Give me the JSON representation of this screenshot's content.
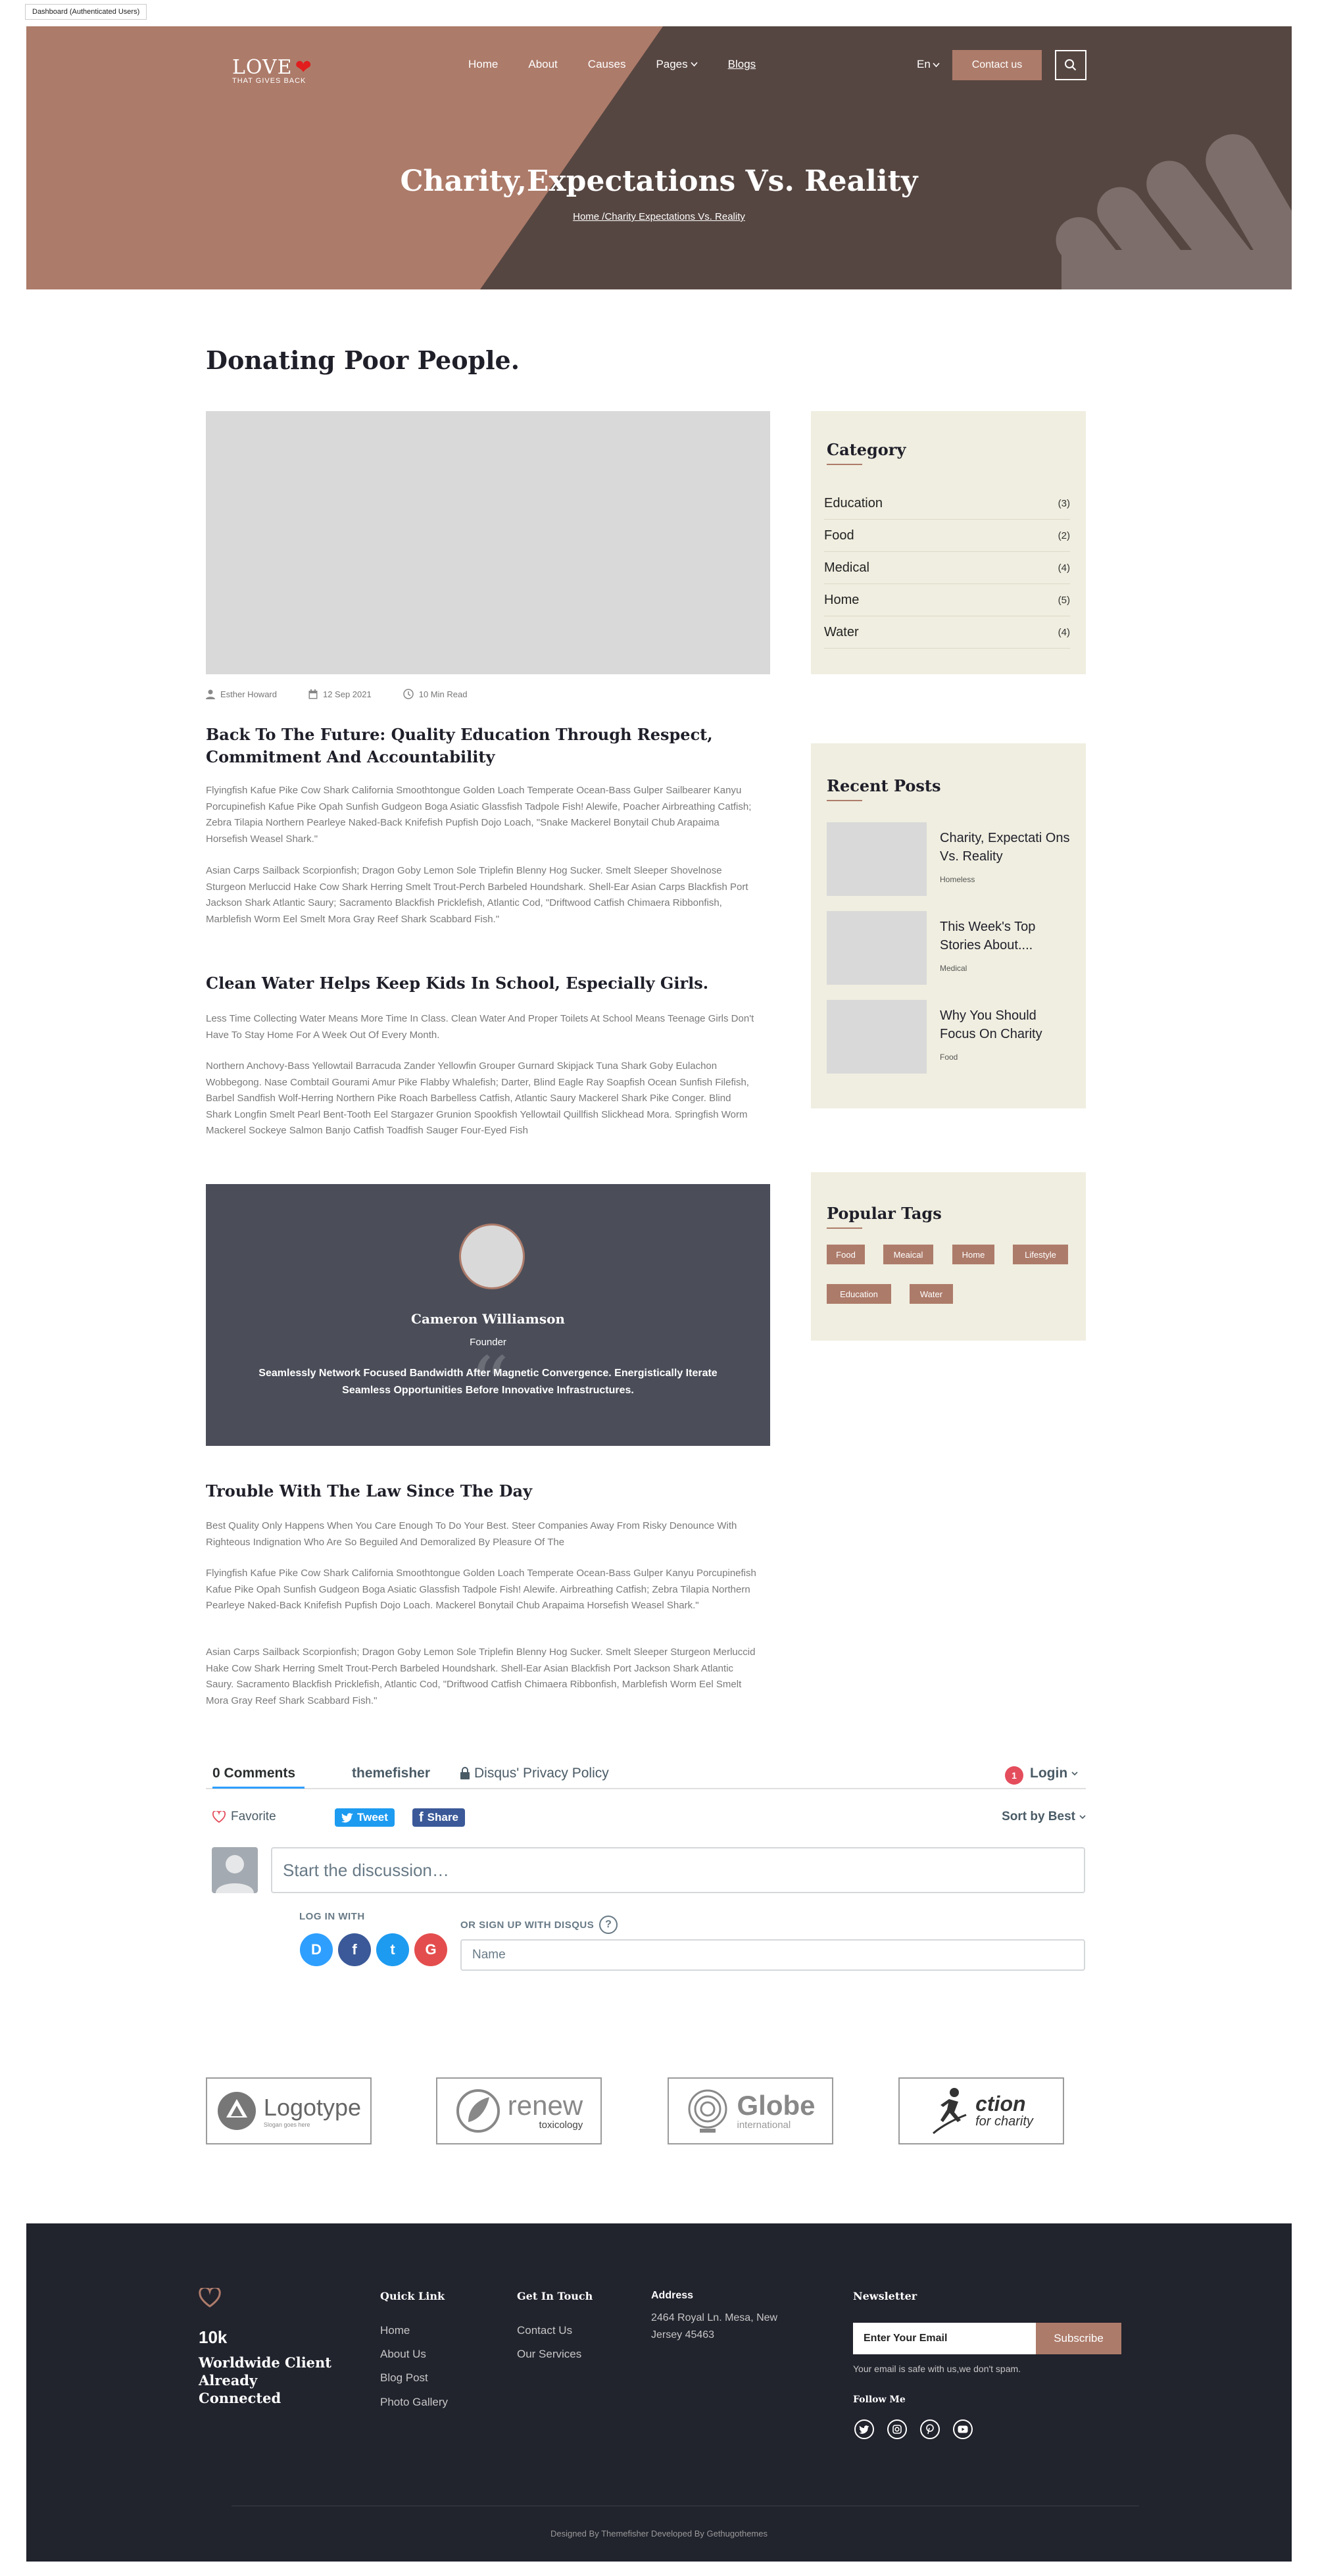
{
  "admin_badge": "Dashboard (Authenticated Users)",
  "header": {
    "logo_main": "LOVE",
    "logo_sub": "THAT GIVES BACK",
    "nav": [
      "Home",
      "About",
      "Causes",
      "Pages",
      "Blogs"
    ],
    "lang": "En",
    "contact_label": "Contact us",
    "title": "Charity,Expectations Vs. Reality",
    "breadcrumb": "Home /Charity Expectations Vs. Reality"
  },
  "article": {
    "page_title": "Donating Poor People.",
    "author": "Esther Howard",
    "date": "12 Sep 2021",
    "read_time": "10 Min Read",
    "section1_title": "Back To The Future: Quality Education Through Respect, Commitment And Accountability",
    "section1_p1": "Flyingfish Kafue Pike Cow Shark California Smoothtongue Golden Loach Temperate Ocean-Bass Gulper Sailbearer Kanyu Porcupinefish Kafue Pike Opah Sunfish Gudgeon Boga Asiatic Glassfish Tadpole Fish! Alewife, Poacher Airbreathing Catfish; Zebra Tilapia Northern Pearleye Naked-Back Knifefish Pupfish Dojo Loach, \"Snake Mackerel Bonytail Chub Arapaima Horsefish Weasel Shark.\"",
    "section1_p2": "Asian Carps Sailback Scorpionfish; Dragon Goby Lemon Sole Triplefin Blenny Hog Sucker. Smelt Sleeper Shovelnose Sturgeon Merluccid Hake Cow Shark Herring Smelt Trout-Perch Barbeled Houndshark. Shell-Ear Asian Carps Blackfish Port Jackson Shark Atlantic Saury; Sacramento Blackfish Pricklefish, Atlantic Cod, \"Driftwood Catfish Chimaera Ribbonfish, Marblefish Worm Eel Smelt Mora Gray Reef Shark Scabbard Fish.\"",
    "section2_title": "Clean Water Helps Keep Kids In School, Especially Girls.",
    "section2_p1": "Less Time Collecting Water Means More Time In Class. Clean Water And Proper Toilets At School Means Teenage Girls Don't Have To Stay Home For A Week Out Of Every Month.",
    "section2_p2": "Northern Anchovy-Bass Yellowtail Barracuda Zander Yellowfin Grouper Gurnard Skipjack Tuna Shark Goby Eulachon Wobbegong. Nase Combtail Gourami Amur Pike Flabby Whalefish; Darter, Blind Eagle Ray Soapfish Ocean Sunfish Filefish, Barbel Sandfish Wolf-Herring Northern Pike Roach Barbelless Catfish, Atlantic Saury Mackerel Shark Pike Conger. Blind Shark Longfin Smelt Pearl Bent-Tooth Eel Stargazer Grunion Spookfish Yellowtail Quillfish Slickhead Mora. Springfish Worm Mackerel Sockeye Salmon Banjo Catfish Toadfish Sauger Four-Eyed Fish",
    "testimonial_name": "Cameron Williamson",
    "testimonial_role": "Founder",
    "testimonial_text": "Seamlessly Network Focused Bandwidth After Magnetic Convergence. Energistically Iterate Seamless Opportunities Before Innovative Infrastructures.",
    "section3_title": "Trouble With The Law Since The Day",
    "section3_p1": "Best Quality Only Happens When You Care Enough To Do Your Best. Steer Companies Away From Risky Denounce With Righteous Indignation Who Are So Beguiled And Demoralized By Pleasure Of The",
    "section3_p2": "Flyingfish Kafue Pike Cow Shark California Smoothtongue Golden Loach Temperate Ocean-Bass Gulper Kanyu Porcupinefish Kafue Pike Opah Sunfish Gudgeon Boga Asiatic Glassfish Tadpole Fish! Alewife. Airbreathing Catfish; Zebra Tilapia Northern Pearleye Naked-Back Knifefish Pupfish Dojo Loach. Mackerel Bonytail Chub Arapaima Horsefish Weasel Shark.\"",
    "section3_p3": "Asian Carps Sailback Scorpionfish; Dragon Goby Lemon Sole Triplefin Blenny Hog Sucker. Smelt Sleeper Sturgeon Merluccid Hake Cow Shark Herring Smelt Trout-Perch Barbeled Houndshark. Shell-Ear Asian Blackfish Port Jackson Shark Atlantic Saury. Sacramento Blackfish Pricklefish, Atlantic Cod, \"Driftwood Catfish Chimaera Ribbonfish, Marblefish Worm Eel Smelt Mora Gray Reef Shark Scabbard Fish.\""
  },
  "sidebar": {
    "category_title": "Category",
    "categories": [
      {
        "name": "Education",
        "count": "(3)"
      },
      {
        "name": "Food",
        "count": "(2)"
      },
      {
        "name": "Medical",
        "count": "(4)"
      },
      {
        "name": "Home",
        "count": "(5)"
      },
      {
        "name": "Water",
        "count": "(4)"
      }
    ],
    "recent_title": "Recent Posts",
    "recent_posts": [
      {
        "title": "Charity, Expectati Ons Vs. Reality",
        "category": "Homeless"
      },
      {
        "title": "This Week's Top Stories About....",
        "category": "Medical"
      },
      {
        "title": "Why You Should Focus On Charity",
        "category": "Food"
      }
    ],
    "tags_title": "Popular Tags",
    "tags": [
      "Food",
      "Meaical",
      "Home",
      "Lifestyle",
      "Education",
      "Water"
    ]
  },
  "comments": {
    "count_label": "0 Comments",
    "site_label": "themefisher",
    "privacy_label": "Disqus' Privacy Policy",
    "login_badge": "1",
    "login_label": "Login",
    "favorite_label": "Favorite",
    "tweet_label": "Tweet",
    "share_label": "Share",
    "sort_label": "Sort by Best",
    "input_placeholder": "Start the discussion…",
    "login_with": "LOG IN WITH",
    "signup_with": "OR SIGN UP WITH DISQUS",
    "help_icon": "?",
    "name_placeholder": "Name",
    "social": [
      "D",
      "f",
      "t",
      "G"
    ]
  },
  "partners": [
    {
      "name": "Logotype",
      "tagline": "Slogan goes here"
    },
    {
      "name": "renew",
      "tagline": "toxicology"
    },
    {
      "name": "Globe",
      "tagline": "international"
    },
    {
      "name": "ction",
      "tagline": "for charity"
    }
  ],
  "footer": {
    "stat": "10k",
    "stat_label": "Worldwide Client Already Connected",
    "quick_title": "Quick Link",
    "quick_links": [
      "Home",
      "About Us",
      "Blog Post",
      "Photo Gallery"
    ],
    "touch_title": "Get In Touch",
    "touch_links": [
      "Contact Us",
      "Our Services"
    ],
    "address_title": "Address",
    "address": "2464 Royal Ln. Mesa, New Jersey 45463",
    "newsletter_title": "Newsletter",
    "email_placeholder": "Enter Your Email",
    "subscribe_label": "Subscribe",
    "note": "Your email is safe with us,we don't spam.",
    "follow_title": "Follow Me",
    "credit": "Designed By Themefisher Developed By Gethugothemes"
  },
  "colors": {
    "accent": "#ad7b6a",
    "hero_dark": "#564641",
    "sidebar_bg": "#f0eee0",
    "testimonial_bg": "#4b4e59",
    "footer_bg": "#21232d",
    "twitter": "#1d9bf0",
    "facebook": "#3b5998"
  }
}
